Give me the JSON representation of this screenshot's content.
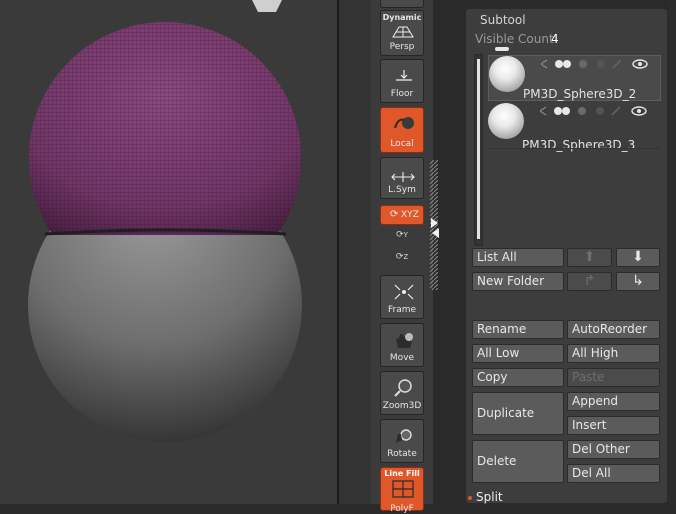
{
  "shelf": {
    "dynamic_label": "Dynamic",
    "persp_label": "Persp",
    "floor_label": "Floor",
    "local_label": "Local",
    "lsym_label": "L.Sym",
    "xyz_label": "XYZ",
    "y_label": "Y",
    "z_label": "Z",
    "frame_label": "Frame",
    "move_label": "Move",
    "zoom_label": "Zoom3D",
    "rotate_label": "Rotate",
    "linefill_label": "Line Fill",
    "polyf_label": "PolyF"
  },
  "subtool": {
    "title": "Subtool",
    "visible_count_label": "Visible Count",
    "visible_count_value": "4",
    "items": [
      {
        "name": "PM3D_Sphere3D_2"
      },
      {
        "name": "PM3D_Sphere3D_3"
      }
    ],
    "buttons": {
      "list_all": "List All",
      "new_folder": "New Folder",
      "rename": "Rename",
      "auto_reorder": "AutoReorder",
      "all_low": "All Low",
      "all_high": "All High",
      "copy": "Copy",
      "paste": "Paste",
      "duplicate": "Duplicate",
      "append": "Append",
      "insert": "Insert",
      "delete": "Delete",
      "del_other": "Del Other",
      "del_all": "Del All"
    },
    "split_label": "Split"
  },
  "colors": {
    "accent_orange": "#e0582a",
    "upper_sphere": "#7f3a72",
    "lower_sphere": "#888888"
  }
}
